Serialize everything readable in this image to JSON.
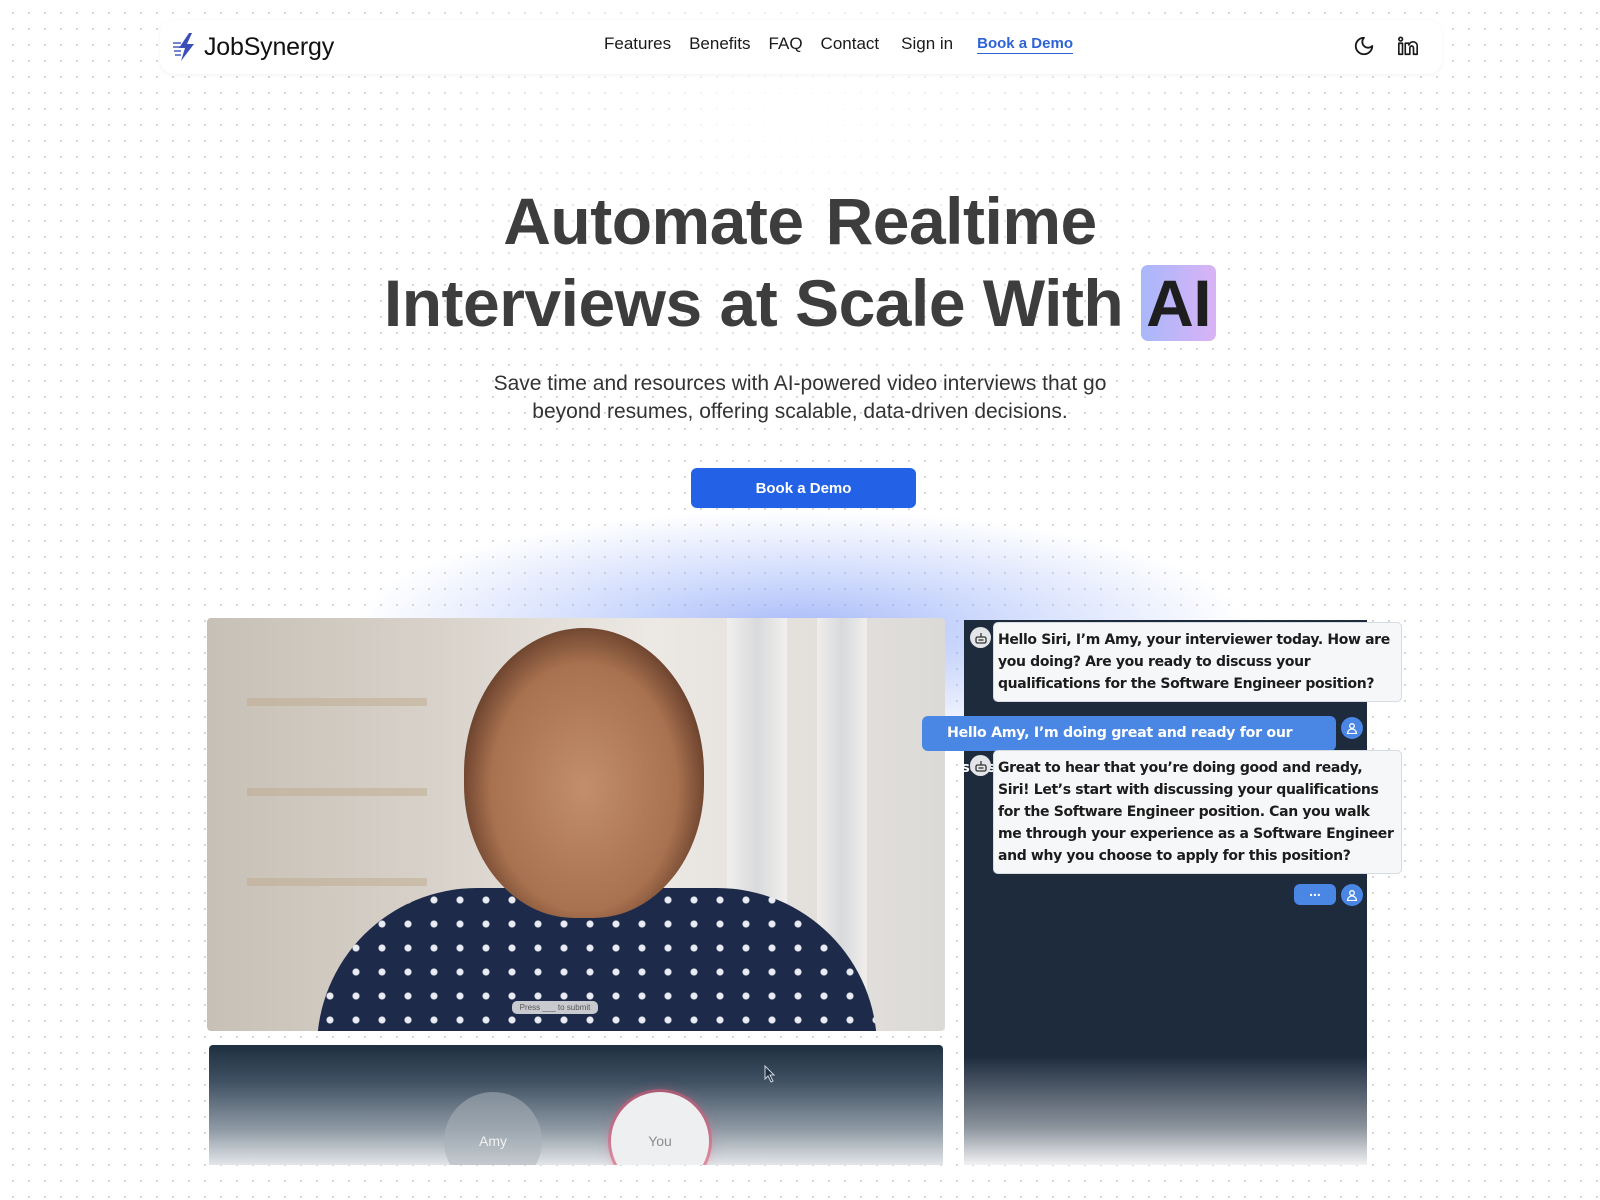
{
  "brand": {
    "name": "JobSynergy",
    "logo_icon": "lightning-bolt-icon",
    "logo_color": "#3a4fb8"
  },
  "nav": {
    "links": [
      {
        "label": "Features"
      },
      {
        "label": "Benefits"
      },
      {
        "label": "FAQ"
      },
      {
        "label": "Contact"
      },
      {
        "label": "Sign in"
      }
    ],
    "demo_link": "Book a Demo",
    "icons": [
      "moon-icon",
      "linkedin-icon"
    ],
    "accent_color": "#2d63d6"
  },
  "hero": {
    "title_line1_word1": "Automate",
    "title_line1_word2": "Realtime",
    "title_line2": "Interviews at Scale With",
    "title_highlight": "AI",
    "subtitle_line1": "Save time and resources with AI-powered video interviews that go",
    "subtitle_line2": "beyond resumes, offering scalable, data-driven decisions.",
    "cta_label": "Book a Demo",
    "cta_color": "#2361e6"
  },
  "demo": {
    "video_hint": "Press ___ to submit",
    "participants": [
      {
        "name": "Amy"
      },
      {
        "name": "You"
      }
    ],
    "chat": [
      {
        "role": "bot",
        "text": "Hello Siri, I’m Amy, your interviewer today. How are you doing? Are you ready to discuss your qualifications for the Software Engineer position?"
      },
      {
        "role": "user",
        "text": "Hello Amy, I’m doing great and ready for our discussion."
      },
      {
        "role": "bot",
        "text": "Great to hear that you’re doing good and ready, Siri! Let’s start with discussing your qualifications for the Software Engineer position. Can you walk me through your experience as a Software Engineer and why you choose to apply for this position?"
      },
      {
        "role": "user",
        "text": "..."
      }
    ]
  }
}
